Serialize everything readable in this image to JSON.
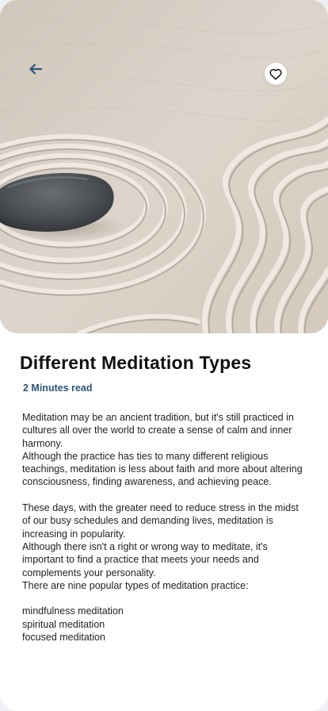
{
  "header": {
    "back_icon": "arrow-left-icon",
    "favorite_icon": "heart-outline-icon"
  },
  "article": {
    "title": "Different Meditation Types",
    "read_time": "2 Minutes read",
    "paragraphs": [
      "Meditation may be an ancient tradition, but it's still practiced in cultures all over the world to create a sense of calm and inner harmony.",
      "Although the practice has ties to many different religious teachings, meditation is less about faith and more about altering consciousness, finding awareness, and achieving peace.",
      "These days, with the greater need to reduce stress in the midst of our busy schedules and demanding lives, meditation is increasing in popularity.",
      "Although there isn't a right or wrong way to meditate, it's important to find a practice that meets your needs and complements your personality.",
      "There are nine popular types of meditation practice:"
    ],
    "types": [
      "mindfulness meditation",
      "spiritual meditation",
      "focused meditation"
    ]
  },
  "colors": {
    "accent": "#2d5478",
    "sand": "#d9d0c6",
    "stone": "#4a4d52"
  }
}
